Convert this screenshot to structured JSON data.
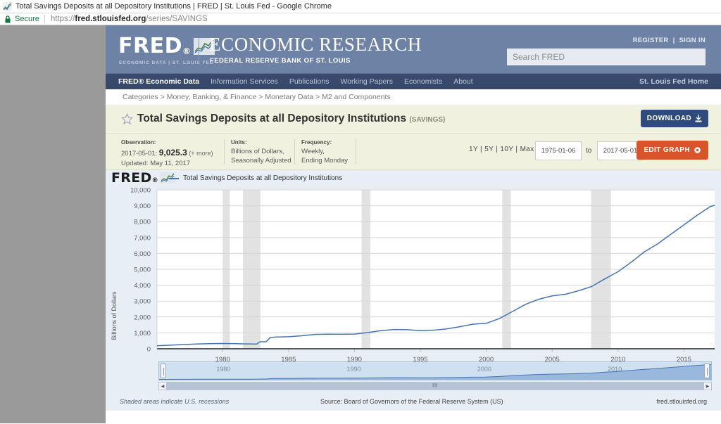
{
  "browser": {
    "tab_title": "Total Savings Deposits at all Depository Institutions | FRED | St. Louis Fed - Google Chrome",
    "security_label": "Secure",
    "url_scheme": "https://",
    "url_host": "fred.stlouisfed.org",
    "url_path": "/series/SAVINGS"
  },
  "masthead": {
    "logo_word": "FRED",
    "logo_dot": "®",
    "logo_sub": "ECONOMIC DATA  |  ST. LOUIS FED",
    "title": "ECONOMIC RESEARCH",
    "subtitle": "FEDERAL RESERVE BANK OF ST. LOUIS",
    "register": "REGISTER",
    "divider": "|",
    "signin": "SIGN IN",
    "search_placeholder": "Search FRED",
    "search_value": ""
  },
  "nav": {
    "items": [
      {
        "label": "FRED® Economic Data",
        "active": true
      },
      {
        "label": "Information Services",
        "active": false
      },
      {
        "label": "Publications",
        "active": false
      },
      {
        "label": "Working Papers",
        "active": false
      },
      {
        "label": "Economists",
        "active": false
      },
      {
        "label": "About",
        "active": false
      }
    ],
    "right_link": "St. Louis Fed Home"
  },
  "breadcrumb": {
    "text": "Categories > Money, Banking, & Finance > Monetary Data > M2 and Components"
  },
  "title_panel": {
    "series_title": "Total Savings Deposits at all Depository Institutions",
    "series_id": "(SAVINGS)",
    "download_label": "DOWNLOAD",
    "star_icon": "star-icon",
    "download_icon": "download-icon"
  },
  "meta": {
    "observation_label": "Observation:",
    "observation_date": "2017-05-01:",
    "observation_value": "9,025.3",
    "observation_more": "(+ more)",
    "updated_text": "Updated: May 11, 2017",
    "units_label": "Units:",
    "units_line1": "Billions of Dollars,",
    "units_line2": "Seasonally Adjusted",
    "frequency_label": "Frequency:",
    "frequency_line1": "Weekly,",
    "frequency_line2": "Ending Monday",
    "range_links": "1Y | 5Y | 10Y | Max",
    "date_from": "1975-01-06",
    "date_to_label": "to",
    "date_to": "2017-05-01",
    "edit_graph_label": "EDIT GRAPH",
    "edit_graph_icon": "gear-icon"
  },
  "graph": {
    "logo_word": "FRED",
    "logo_dot": "®",
    "legend_label": "Total Savings Deposits at all Depository Institutions",
    "slider_years": [
      "1980",
      "1990",
      "2000",
      "2010"
    ],
    "scrollbar_left_arrow": "◀",
    "scrollbar_right_arrow": "▶",
    "scrollbar_grip": "‖‖"
  },
  "footer": {
    "left": "Shaded areas indicate U.S. recessions",
    "center": "Source: Board of Governors of the Federal Reserve System (US)",
    "right": "fred.stlouisfed.org"
  },
  "colors": {
    "masthead_blue": "#6e82a6",
    "nav_blue": "#38496b",
    "title_cream": "#f1f1e0",
    "download_blue": "#2f4b7c",
    "edit_orange": "#d9542b",
    "series_line": "#4673b5",
    "recession_band": "#e2e2e2",
    "graph_bg": "#e8eef5"
  },
  "chart_data": {
    "type": "line",
    "title": "Total Savings Deposits at all Depository Institutions",
    "xlabel": "",
    "ylabel": "Billions of Dollars",
    "ylim": [
      0,
      10000
    ],
    "xlim": [
      1975.02,
      2017.33
    ],
    "yticks": [
      0,
      1000,
      2000,
      3000,
      4000,
      5000,
      6000,
      7000,
      8000,
      9000,
      10000
    ],
    "ytick_labels": [
      "0",
      "1,000",
      "2,000",
      "3,000",
      "4,000",
      "5,000",
      "6,000",
      "7,000",
      "8,000",
      "9,000",
      "10,000"
    ],
    "xticks": [
      1980,
      1985,
      1990,
      1995,
      2000,
      2005,
      2010,
      2015
    ],
    "xtick_labels": [
      "1980",
      "1985",
      "1990",
      "1995",
      "2000",
      "2005",
      "2010",
      "2015"
    ],
    "grid": "horizontal",
    "legend_position": "top",
    "line_color": "#4673b5",
    "recessions": [
      [
        1980.0,
        1980.54
      ],
      [
        1981.54,
        1982.87
      ],
      [
        1990.54,
        1991.21
      ],
      [
        2001.21,
        2001.87
      ],
      [
        2007.96,
        2009.46
      ]
    ],
    "series": [
      {
        "name": "Total Savings Deposits at all Depository Institutions",
        "x": [
          1975.02,
          1976.0,
          1977.0,
          1978.0,
          1979.0,
          1980.0,
          1980.5,
          1981.0,
          1981.5,
          1982.0,
          1982.4,
          1982.6,
          1982.8,
          1983.0,
          1983.3,
          1983.6,
          1984.0,
          1985.0,
          1986.0,
          1987.0,
          1988.0,
          1989.0,
          1990.0,
          1991.0,
          1992.0,
          1993.0,
          1994.0,
          1995.0,
          1996.0,
          1997.0,
          1998.0,
          1999.0,
          2000.0,
          2001.0,
          2002.0,
          2003.0,
          2004.0,
          2005.0,
          2006.0,
          2007.0,
          2008.0,
          2009.0,
          2010.0,
          2011.0,
          2012.0,
          2013.0,
          2014.0,
          2015.0,
          2016.0,
          2017.0,
          2017.33
        ],
        "y": [
          190,
          225,
          265,
          300,
          320,
          330,
          325,
          318,
          310,
          305,
          300,
          300,
          430,
          440,
          445,
          700,
          735,
          760,
          820,
          900,
          920,
          910,
          925,
          1020,
          1140,
          1210,
          1200,
          1140,
          1170,
          1250,
          1390,
          1550,
          1600,
          1900,
          2350,
          2800,
          3120,
          3330,
          3430,
          3650,
          3920,
          4400,
          4850,
          5450,
          6100,
          6600,
          7200,
          7800,
          8400,
          8950,
          9025
        ]
      }
    ]
  }
}
